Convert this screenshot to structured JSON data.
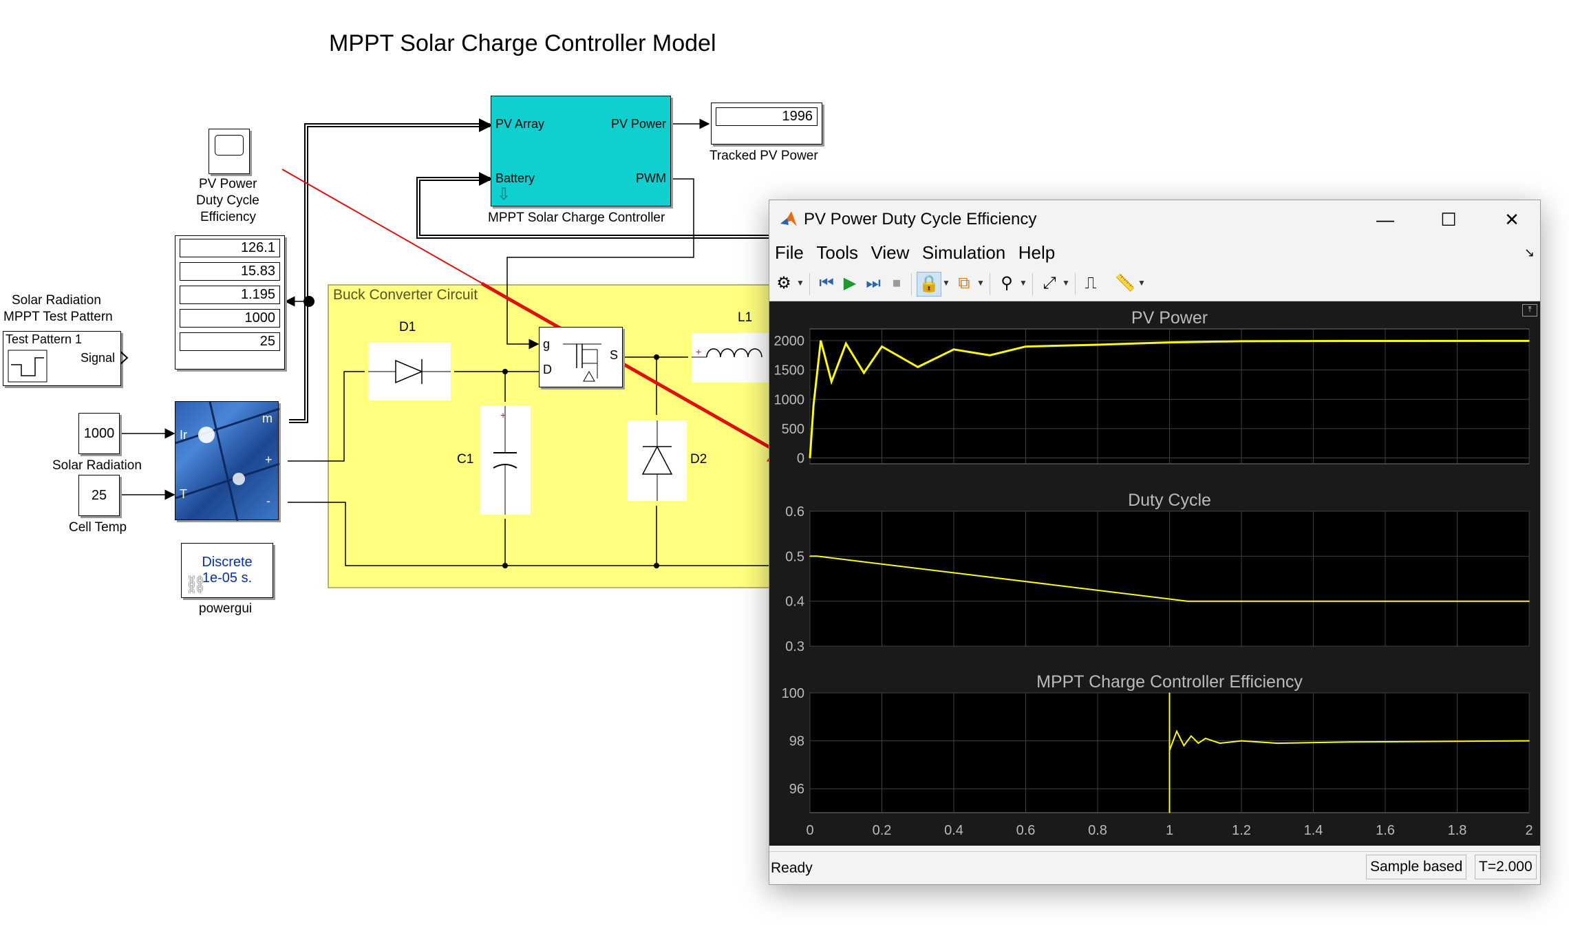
{
  "model": {
    "title": "MPPT Solar Charge Controller Model",
    "scope_block_label": [
      "PV Power",
      "Duty Cycle",
      "Efficiency"
    ],
    "display_values": [
      "126.1",
      "15.83",
      "1.195",
      "1000",
      "25"
    ],
    "test_pattern": {
      "label_lines": [
        "Solar Radiation",
        "MPPT Test Pattern"
      ],
      "name": "Test Pattern 1",
      "port": "Signal"
    },
    "solar_radiation": {
      "value": "1000",
      "label": "Solar Radiation"
    },
    "cell_temp": {
      "value": "25",
      "label": "Cell Temp"
    },
    "pv_array_ports": {
      "ir": "Ir",
      "t": "T",
      "m": "m",
      "plus": "+",
      "minus": "-"
    },
    "powergui": {
      "line1": "Discrete",
      "line2": "1e-05 s.",
      "label": "powergui"
    },
    "controller": {
      "in1": "PV Array",
      "in2": "Battery",
      "out1": "PV Power",
      "out2": "PWM",
      "label": "MPPT Solar Charge Controller"
    },
    "tracked": {
      "value": "1996",
      "label": "Tracked PV Power"
    },
    "buck": {
      "label": "Buck Converter Circuit",
      "d1": "D1",
      "c1": "C1",
      "d2": "D2",
      "l1": "L1",
      "mosfet_g": "g",
      "mosfet_d": "D",
      "mosfet_s": "S"
    }
  },
  "scope": {
    "title": "PV Power Duty Cycle Efficiency",
    "menu": [
      "File",
      "Tools",
      "View",
      "Simulation",
      "Help"
    ],
    "status": {
      "ready": "Ready",
      "mode": "Sample based",
      "time": "T=2.000"
    },
    "toolbar_icons": [
      "settings-icon",
      "step-back-icon",
      "run-icon",
      "step-forward-icon",
      "stop-icon",
      "lock-icon",
      "signal-selector-icon",
      "triggers-icon",
      "autoscale-icon",
      "data-cursor-icon",
      "measurements-icon"
    ],
    "colors": {
      "trace": "#ffff00",
      "background": "#000000",
      "frame": "#1a1a1a",
      "grid": "#404040",
      "text": "#bbbbbb"
    }
  },
  "chart_data": [
    {
      "type": "line",
      "title": "PV Power",
      "xlim": [
        0,
        2
      ],
      "ylim": [
        -100,
        2200
      ],
      "yticks": [
        0,
        500,
        1000,
        1500,
        2000
      ],
      "series": [
        {
          "x": [
            0,
            0.01,
            0.03,
            0.06,
            0.1,
            0.15,
            0.2,
            0.3,
            0.4,
            0.5,
            0.6,
            0.8,
            1.0,
            1.2,
            1.5,
            2.0
          ],
          "y": [
            0,
            900,
            2000,
            1300,
            1950,
            1450,
            1900,
            1550,
            1850,
            1750,
            1900,
            1930,
            1970,
            1990,
            1995,
            1996
          ]
        }
      ]
    },
    {
      "type": "line",
      "title": "Duty Cycle",
      "xlim": [
        0,
        2
      ],
      "ylim": [
        0.3,
        0.6
      ],
      "yticks": [
        0.3,
        0.4,
        0.5,
        0.6
      ],
      "series": [
        {
          "x": [
            0,
            0.02,
            1.05,
            2.0
          ],
          "y": [
            0.5,
            0.5,
            0.4,
            0.4
          ]
        }
      ]
    },
    {
      "type": "line",
      "title": "MPPT Charge Controller Efficiency",
      "xlim": [
        0,
        2
      ],
      "ylim": [
        95,
        100
      ],
      "yticks": [
        96,
        98,
        100
      ],
      "xticks": [
        0,
        0.2,
        0.4,
        0.6,
        0.8,
        1,
        1.2,
        1.4,
        1.6,
        1.8,
        2
      ],
      "xticklabels": [
        "0",
        "0.2",
        "0.4",
        "0.6",
        "0.8",
        "1",
        "1.2",
        "1.4",
        "1.6",
        "1.8",
        "2"
      ],
      "series": [
        {
          "x": [
            1.0,
            1.0,
            1.0,
            1.02,
            1.04,
            1.06,
            1.08,
            1.1,
            1.14,
            1.2,
            1.3,
            1.5,
            2.0
          ],
          "y": [
            95,
            100,
            97.6,
            98.4,
            97.8,
            98.2,
            97.9,
            98.1,
            97.9,
            98.0,
            97.9,
            97.95,
            98.0
          ]
        }
      ]
    }
  ]
}
